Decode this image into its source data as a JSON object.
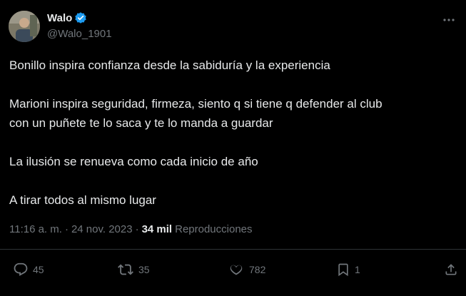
{
  "author": {
    "name": "Walo",
    "handle": "@Walo_1901",
    "verified": true,
    "verified_color": "#1d9bf0"
  },
  "tweet": {
    "paragraphs": [
      [
        "Bonillo inspira confianza desde la sabiduría y la experiencia"
      ],
      [
        "Marioni inspira seguridad, firmeza, siento q si tiene q defender al club",
        "con un puñete te lo saca y te lo manda a guardar"
      ],
      [
        "La ilusión se renueva como cada inicio de año"
      ],
      [
        "A tirar todos al mismo lugar"
      ]
    ]
  },
  "meta": {
    "time": "11:16 a. m.",
    "separator": "·",
    "date": "24 nov. 2023",
    "views_count": "34 mil",
    "views_label": "Reproducciones"
  },
  "actions": {
    "replies": {
      "icon": "reply-icon",
      "count": "45"
    },
    "reposts": {
      "icon": "repost-icon",
      "count": "35"
    },
    "likes": {
      "icon": "heart-icon",
      "count": "782"
    },
    "bookmarks": {
      "icon": "bookmark-icon",
      "count": "1"
    },
    "share": {
      "icon": "share-icon"
    }
  },
  "colors": {
    "background": "#000000",
    "text": "#e7e9ea",
    "muted": "#71767b",
    "divider": "#2f3336"
  }
}
